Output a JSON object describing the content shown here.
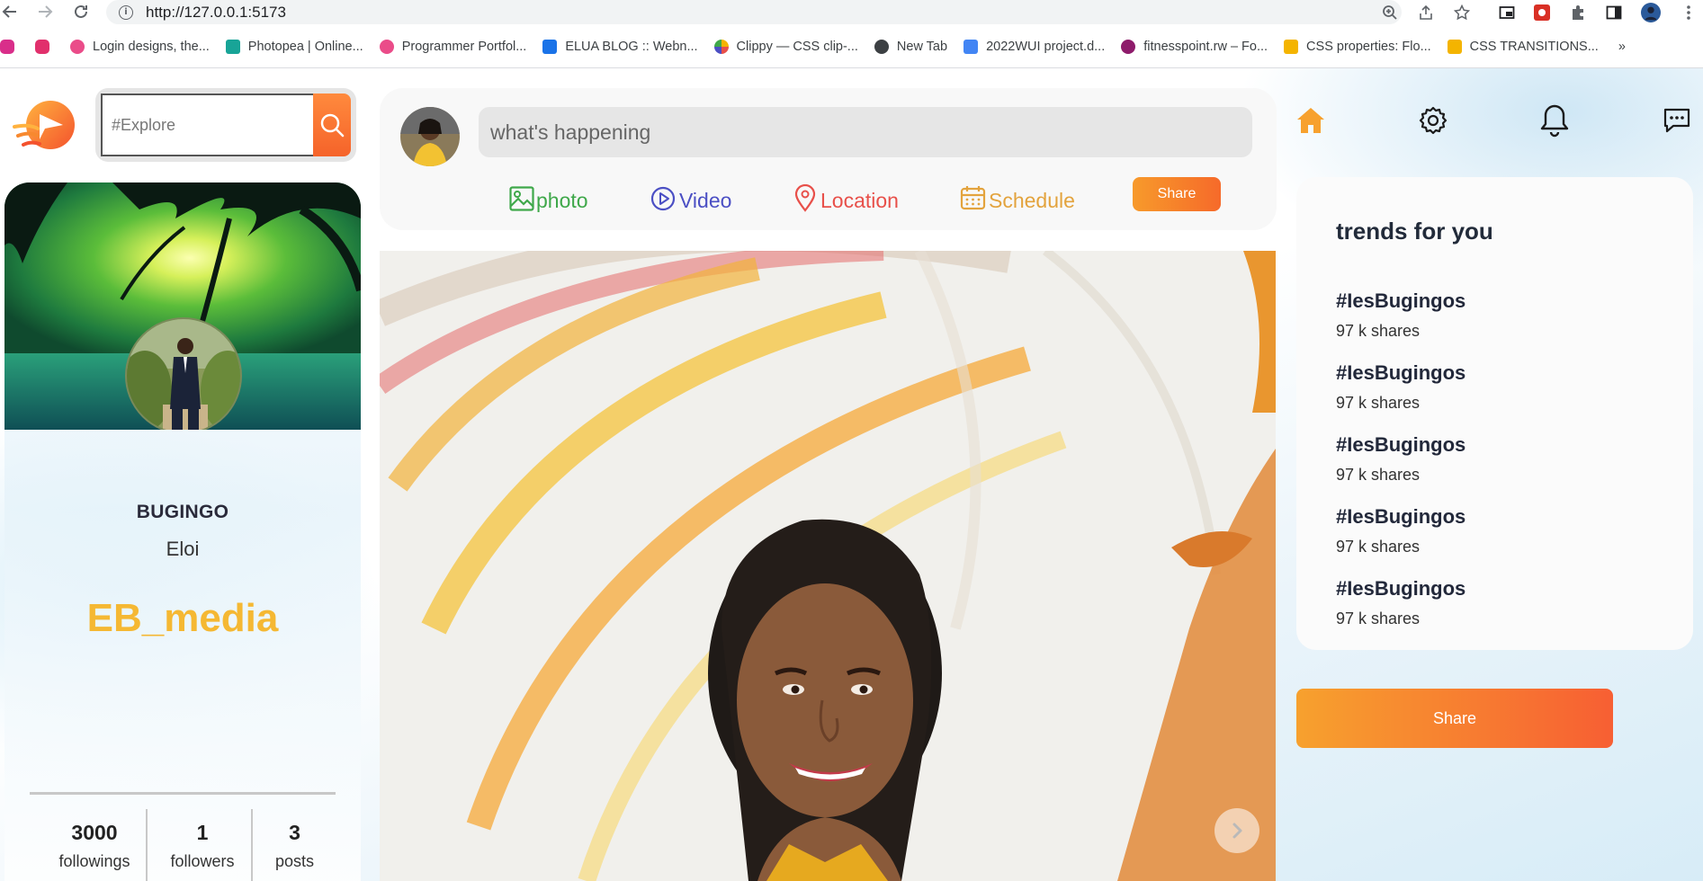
{
  "browser": {
    "url": "http://127.0.0.1:5173",
    "bookmarks": [
      {
        "label": "",
        "color": "#d92e8a"
      },
      {
        "label": "",
        "color": "#e1306c"
      },
      {
        "label": "Login designs, the...",
        "color": "#ea4c89"
      },
      {
        "label": "Photopea | Online...",
        "color": "#18a497"
      },
      {
        "label": "Programmer Portfol...",
        "color": "#ea4c89"
      },
      {
        "label": "ELUA BLOG :: Webn...",
        "color": "#1a73e8"
      },
      {
        "label": "Clippy — CSS clip-...",
        "color": "#f4b400"
      },
      {
        "label": "New Tab",
        "color": "#3c4043"
      },
      {
        "label": "2022WUI project.d...",
        "color": "#4285f4"
      },
      {
        "label": "fitnesspoint.rw – Fo...",
        "color": "#8e1b6b"
      },
      {
        "label": "CSS properties: Flo...",
        "color": "#f4b400"
      },
      {
        "label": "CSS TRANSITIONS...",
        "color": "#f4b400"
      }
    ],
    "more": "»"
  },
  "search": {
    "placeholder": "#Explore"
  },
  "profile": {
    "name": "BUGINGO",
    "subname": "Eloi",
    "handle": "EB_media",
    "stats": [
      {
        "value": "3000",
        "label": "followings"
      },
      {
        "value": "1",
        "label": "followers"
      },
      {
        "value": "3",
        "label": "posts"
      }
    ]
  },
  "composer": {
    "placeholder": "what's happening",
    "options": [
      {
        "label": "photo",
        "color": "#3fa84a",
        "icon": "image-icon"
      },
      {
        "label": "Video",
        "color": "#4b4fc4",
        "icon": "play-circle-icon"
      },
      {
        "label": "Location",
        "color": "#e8504a",
        "icon": "location-pin-icon"
      },
      {
        "label": "Schedule",
        "color": "#e3a33d",
        "icon": "calendar-icon"
      }
    ],
    "share_label": "Share"
  },
  "trends": {
    "title": "trends for you",
    "items": [
      {
        "tag": "#IesBugingos",
        "shares": "97 k shares"
      },
      {
        "tag": "#IesBugingos",
        "shares": "97 k shares"
      },
      {
        "tag": "#IesBugingos",
        "shares": "97 k shares"
      },
      {
        "tag": "#IesBugingos",
        "shares": "97 k shares"
      },
      {
        "tag": "#IesBugingos",
        "shares": "97 k shares"
      }
    ]
  },
  "share_button": "Share",
  "colors": {
    "accent": "#f7822b",
    "handle": "#f5b833",
    "home": "#f7a12e"
  }
}
